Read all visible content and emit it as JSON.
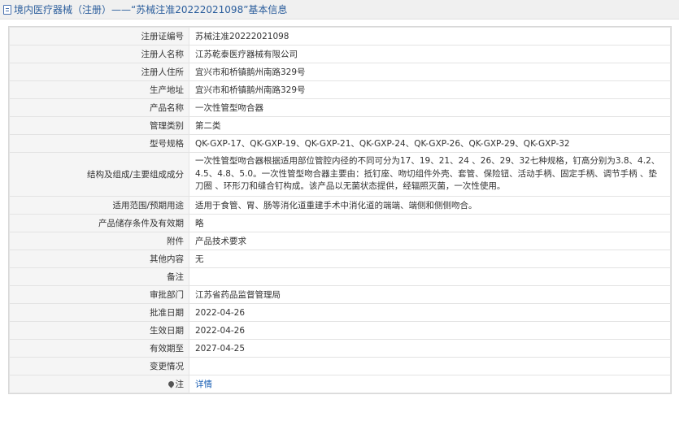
{
  "header": {
    "title": "境内医疗器械（注册）——“苏械注准20222021098”基本信息"
  },
  "rows": [
    {
      "label": "注册证编号",
      "value": "苏械注准20222021098"
    },
    {
      "label": "注册人名称",
      "value": "江苏乾泰医疗器械有限公司"
    },
    {
      "label": "注册人住所",
      "value": "宜兴市和桥镇鹅州南路329号"
    },
    {
      "label": "生产地址",
      "value": "宜兴市和桥镇鹅州南路329号"
    },
    {
      "label": "产品名称",
      "value": "一次性管型吻合器"
    },
    {
      "label": "管理类别",
      "value": "第二类"
    },
    {
      "label": "型号规格",
      "value": "QK-GXP-17、QK-GXP-19、QK-GXP-21、QK-GXP-24、QK-GXP-26、QK-GXP-29、QK-GXP-32"
    },
    {
      "label": "结构及组成/主要组成成分",
      "value": "一次性管型吻合器根据适用部位管腔内径的不同可分为17、19、21、24 、26、29、32七种规格，钉高分别为3.8、4.2、4.5、4.8、5.0。一次性管型吻合器主要由：抵钉座、吻切组件外壳、套管、保险钮、活动手柄、固定手柄、调节手柄 、垫刀圈 、环形刀和缝合钉构成。该产品以无菌状态提供，经辐照灭菌，一次性使用。"
    },
    {
      "label": "适用范围/预期用途",
      "value": "适用于食管、胃、肠等消化道重建手术中消化道的端端、端侧和侧侧吻合。"
    },
    {
      "label": "产品储存条件及有效期",
      "value": "略"
    },
    {
      "label": "附件",
      "value": "产品技术要求"
    },
    {
      "label": "其他内容",
      "value": "无"
    },
    {
      "label": "备注",
      "value": ""
    },
    {
      "label": "审批部门",
      "value": "江苏省药品监督管理局"
    },
    {
      "label": "批准日期",
      "value": "2022-04-26"
    },
    {
      "label": "生效日期",
      "value": "2022-04-26"
    },
    {
      "label": "有效期至",
      "value": "2027-04-25"
    },
    {
      "label": "变更情况",
      "value": ""
    }
  ],
  "note": {
    "icon": "pin-icon",
    "label": "注",
    "link_text": "详情"
  },
  "colors": {
    "header_text": "#2a5d9c",
    "link": "#1a5fb4",
    "label_bg": "#f5f5f5"
  }
}
